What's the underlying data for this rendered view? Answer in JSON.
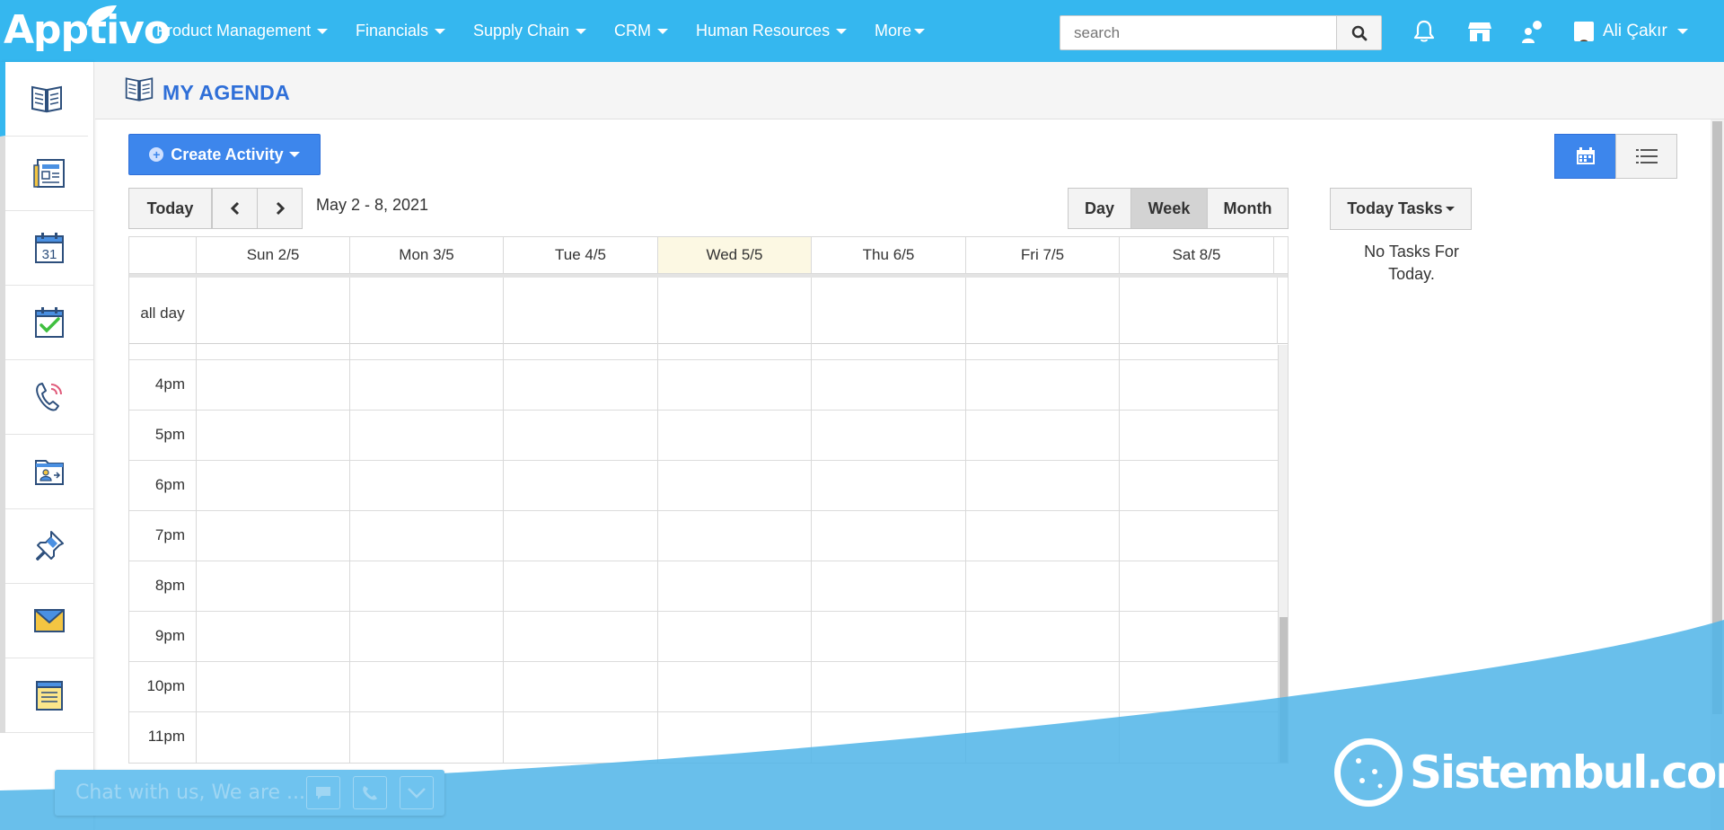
{
  "app": {
    "logo": "Apptivo"
  },
  "topnav": {
    "items": [
      {
        "label": "Product Management"
      },
      {
        "label": "Financials"
      },
      {
        "label": "Supply Chain"
      },
      {
        "label": "CRM"
      },
      {
        "label": "Human Resources"
      },
      {
        "label": "More"
      }
    ],
    "search_placeholder": "search",
    "user_name": "Ali Çakır"
  },
  "sidebar": {
    "items": [
      {
        "icon": "agenda-book-icon"
      },
      {
        "icon": "newspaper-icon"
      },
      {
        "icon": "calendar-31-icon"
      },
      {
        "icon": "task-check-icon"
      },
      {
        "icon": "phone-call-icon"
      },
      {
        "icon": "contact-folder-icon"
      },
      {
        "icon": "pushpin-icon"
      },
      {
        "icon": "envelope-icon"
      },
      {
        "icon": "notepad-icon"
      }
    ],
    "calendar_day": "31"
  },
  "page": {
    "title": "MY AGENDA"
  },
  "toolbar": {
    "create_label": "Create Activity",
    "today_label": "Today",
    "date_range": "May 2 - 8, 2021",
    "view_day": "Day",
    "view_week": "Week",
    "view_month": "Month",
    "active_view": "Week"
  },
  "calendar": {
    "days": [
      "Sun 2/5",
      "Mon 3/5",
      "Tue 4/5",
      "Wed 5/5",
      "Thu 6/5",
      "Fri 7/5",
      "Sat 8/5"
    ],
    "today_index": 3,
    "all_day_label": "all day",
    "time_labels": [
      "4pm",
      "5pm",
      "6pm",
      "7pm",
      "8pm",
      "9pm",
      "10pm",
      "11pm"
    ]
  },
  "tasks": {
    "button_label": "Today Tasks",
    "empty_line1": "No Tasks For",
    "empty_line2": "Today."
  },
  "chat": {
    "text": "Chat with us, We are ..."
  },
  "watermark": {
    "text": "Sistembul.com"
  },
  "colors": {
    "topbar": "#35b7ef",
    "accent_blue": "#3d86ec",
    "title_blue": "#2f6fd8",
    "today_highlight": "#fcf8e3",
    "wave": "#4fb4e8"
  }
}
